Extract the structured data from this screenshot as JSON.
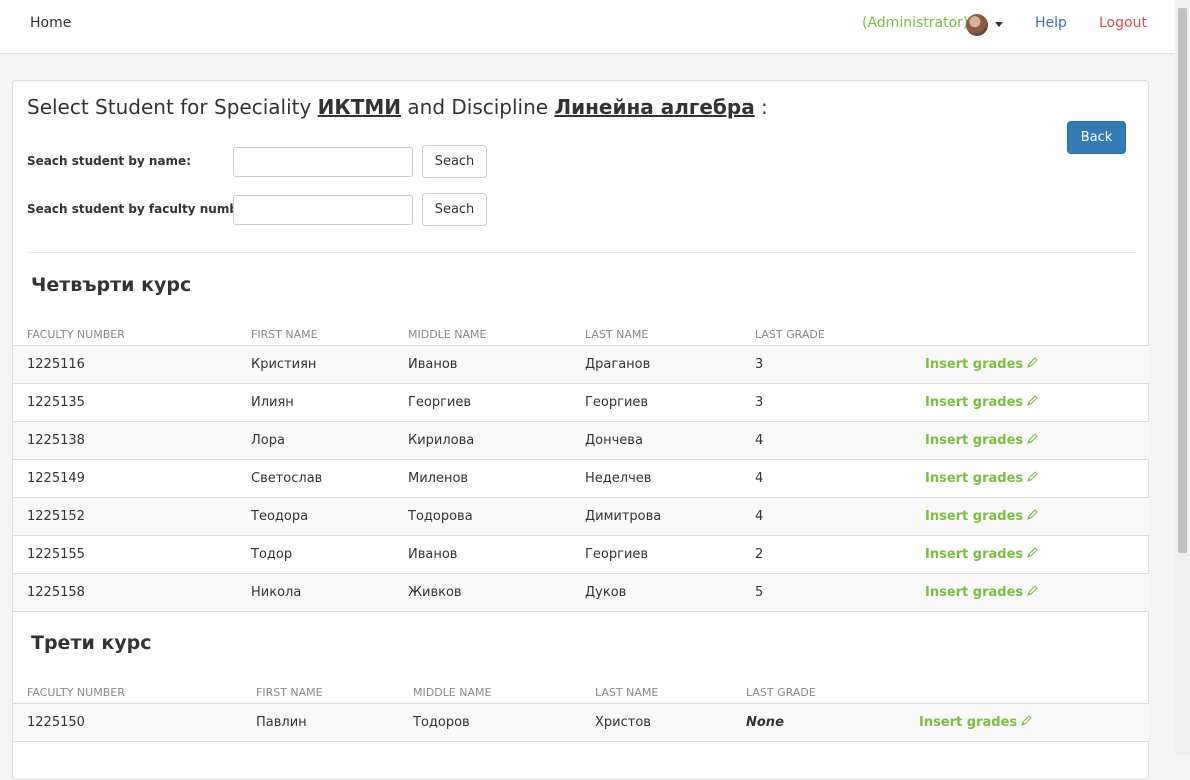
{
  "nav": {
    "home": "Home",
    "user": "(Administrator)",
    "help": "Help",
    "logout": "Logout"
  },
  "page": {
    "title_prefix": "Select Student for Speciality",
    "speciality": "ИКТМИ",
    "title_mid": "and Discipline",
    "discipline": "Линейна алгебра",
    "title_suffix": ":",
    "back_label": "Back"
  },
  "search": {
    "by_name_label": "Seach student by name:",
    "by_name_value": "",
    "by_number_label": "Seach student by faculty number:",
    "by_number_value": "",
    "button_label": "Seach"
  },
  "columns": [
    "Faculty number",
    "First name",
    "Middle name",
    "Last name",
    "Last grade"
  ],
  "action_label": "Insert grades",
  "accent_color": "#7cbd42",
  "sections": [
    {
      "title": "Четвърти курс",
      "rows": [
        {
          "faculty_number": "1225116",
          "first": "Кристиян",
          "middle": "Иванов",
          "last": "Драганов",
          "grade": "3"
        },
        {
          "faculty_number": "1225135",
          "first": "Илиян",
          "middle": "Георгиев",
          "last": "Георгиев",
          "grade": "3"
        },
        {
          "faculty_number": "1225138",
          "first": "Лора",
          "middle": "Кирилова",
          "last": "Дончева",
          "grade": "4"
        },
        {
          "faculty_number": "1225149",
          "first": "Светослав",
          "middle": "Миленов",
          "last": "Неделчев",
          "grade": "4"
        },
        {
          "faculty_number": "1225152",
          "first": "Теодора",
          "middle": "Тодорова",
          "last": "Димитрова",
          "grade": "4"
        },
        {
          "faculty_number": "1225155",
          "first": "Тодор",
          "middle": "Иванов",
          "last": "Георгиев",
          "grade": "2"
        },
        {
          "faculty_number": "1225158",
          "first": "Никола",
          "middle": "Живков",
          "last": "Дуков",
          "grade": "5"
        }
      ]
    },
    {
      "title": "Трети курс",
      "rows": [
        {
          "faculty_number": "1225150",
          "first": "Павлин",
          "middle": "Тодоров",
          "last": "Христов",
          "grade": "None"
        }
      ]
    }
  ]
}
